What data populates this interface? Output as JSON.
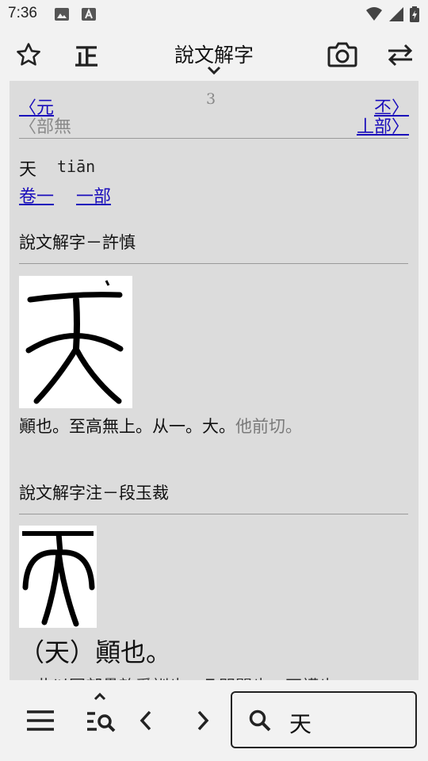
{
  "status": {
    "time": "7:36"
  },
  "toolbar": {
    "title": "說文解字",
    "standard_label": "正"
  },
  "nav": {
    "prev_char": "〈元",
    "prev_radical": "〈部無",
    "page_number": "3",
    "next_char": "丕〉",
    "next_radical": "丄部〉"
  },
  "entry": {
    "character": "天",
    "pinyin": "tiān",
    "volume_link": "卷一",
    "radical_link": "一部"
  },
  "sections": [
    {
      "title": "說文解字－許慎",
      "definition_main": "顚也。至高無上。从一。大。",
      "definition_gray": "他前切。"
    },
    {
      "title": "說文解字注－段玉裁",
      "definition_big": "（天）顚也。",
      "definition_cut": "　此以同部疊韵爲訓也。凡門聞也。戸護也。"
    }
  ],
  "search": {
    "value": "天"
  },
  "colors": {
    "link": "#1a0dbb",
    "panel": "#dcdcdc",
    "bar": "#f2f2f2"
  }
}
